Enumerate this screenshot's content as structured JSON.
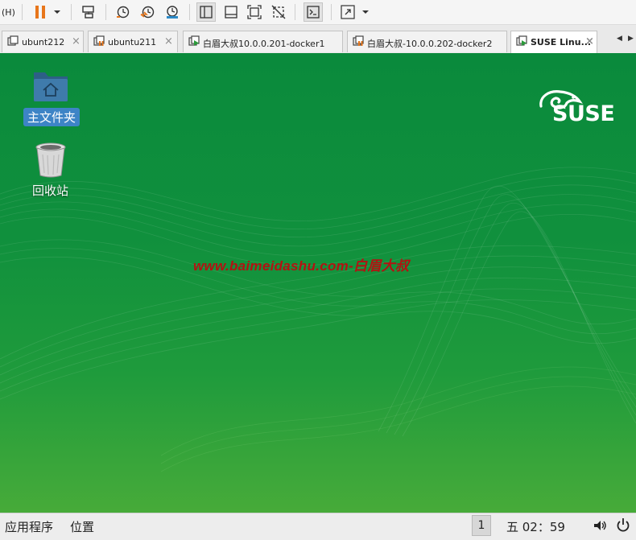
{
  "toolbar": {
    "menu_fragment": "(H)",
    "items": [
      "pause-button",
      "pause-dropdown",
      "send-keys-button",
      "snapshot-button",
      "revert-snapshot-button",
      "snapshot-manager-button",
      "normal-view-button",
      "console-view-button",
      "fit-guest-button",
      "unity-button",
      "terminal-button",
      "fullscreen-button",
      "fullscreen-dropdown"
    ]
  },
  "tabs": [
    {
      "label": "ubunt212",
      "active": false
    },
    {
      "label": "ubuntu211",
      "active": false
    },
    {
      "label": "白眉大叔10.0.0.201-docker1",
      "active": false
    },
    {
      "label": "白眉大叔-10.0.0.202-docker2",
      "active": false
    },
    {
      "label": "SUSE Linu...",
      "active": true
    }
  ],
  "close_glyph": "×",
  "scroll_left": "◀",
  "scroll_right": "▶",
  "desktop": {
    "icons": [
      {
        "label": "主文件夹",
        "icon": "home-folder-icon",
        "selected": true
      },
      {
        "label": "回收站",
        "icon": "trash-icon",
        "selected": false
      }
    ],
    "watermark": "www.baimeidashu.com-白眉大叔",
    "logo_text": "SUSE"
  },
  "taskbar": {
    "applications": "应用程序",
    "places": "位置",
    "workspace": "1",
    "clock": "五 02：59"
  },
  "colors": {
    "desktop_top": "#0a8a3c",
    "desktop_bottom": "#47ab39",
    "selection": "#3d84c6",
    "watermark": "#b31212",
    "pause_orange": "#e8761b"
  }
}
